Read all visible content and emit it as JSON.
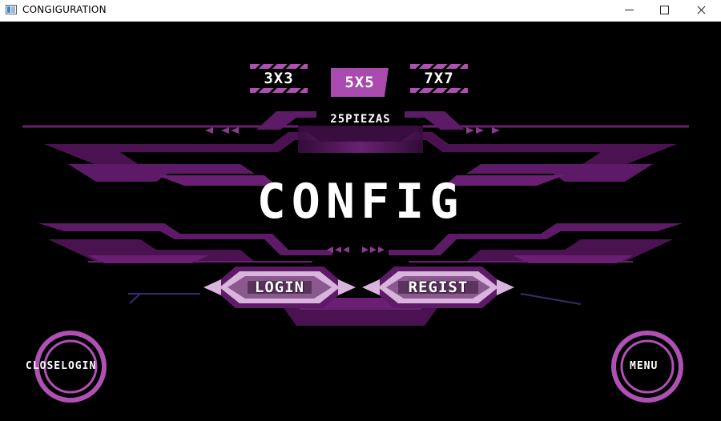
{
  "window": {
    "title": "CONGIGURATION"
  },
  "size_selector": {
    "options": [
      {
        "label": "3X3"
      },
      {
        "label": "5X5"
      },
      {
        "label": "7X7"
      }
    ],
    "selected": "5X5"
  },
  "pieces_text": "25PIEZAS",
  "main_title": "CONFIG",
  "buttons": {
    "login": "LOGIN",
    "regist": "REGIST",
    "close_login": "CLOSELOGIN",
    "menu": "MENU"
  },
  "colors": {
    "accent": "#a94aae",
    "dark_purple": "#4a1250",
    "panel_purple": "#6b1f73",
    "light_pink": "#d9b4dc",
    "background": "#000000"
  }
}
